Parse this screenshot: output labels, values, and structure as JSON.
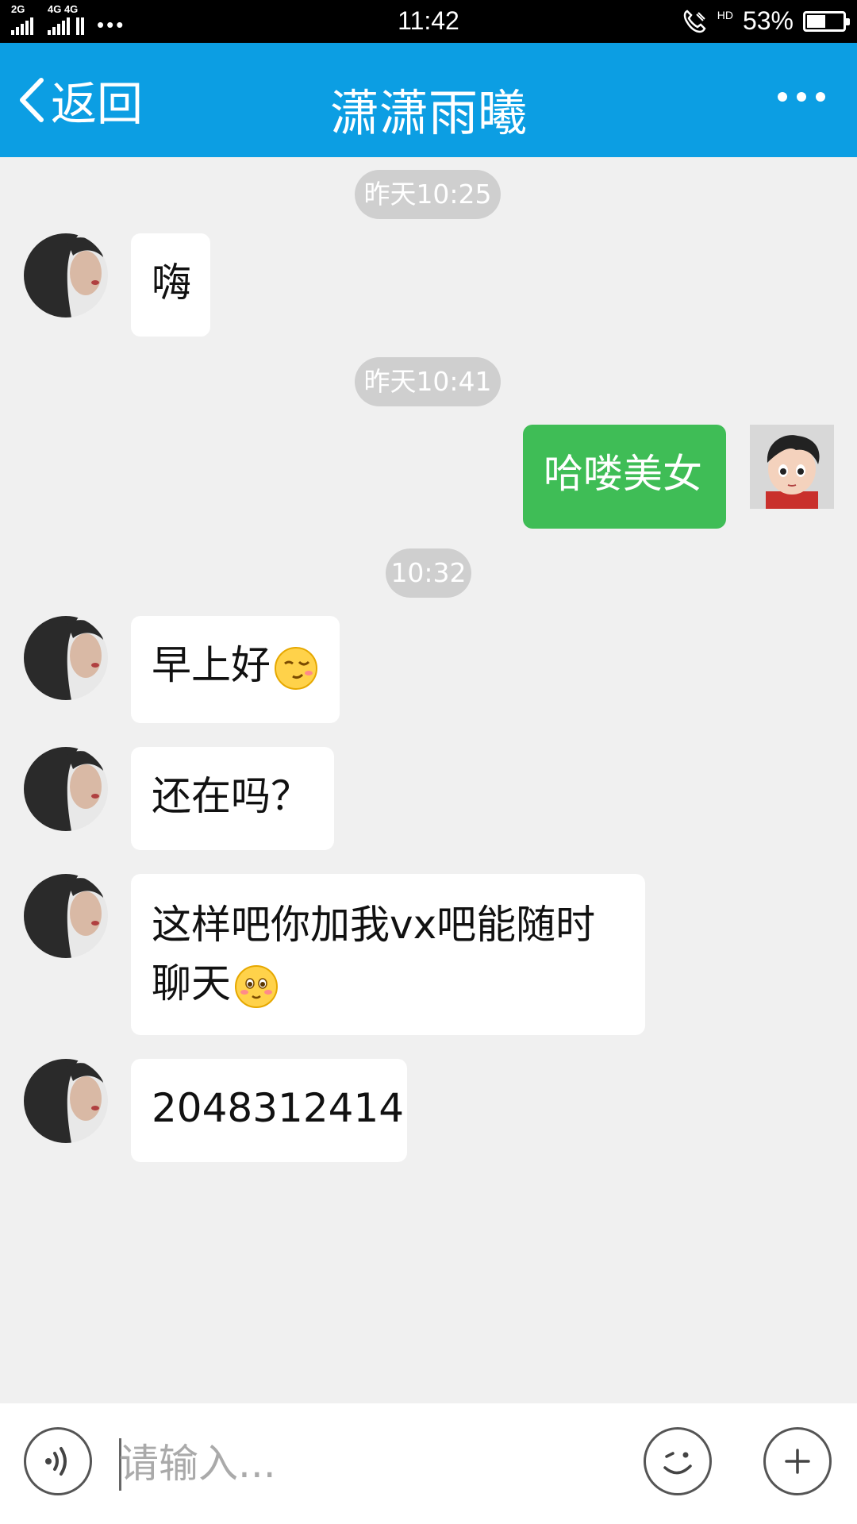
{
  "status_bar": {
    "signal_1_label": "2G",
    "signal_2_label": "4G 4G",
    "more": "•••",
    "time": "11:42",
    "hd": "HD",
    "battery_percent": "53%",
    "battery_level": 0.53
  },
  "header": {
    "back_label": "返回",
    "title": "潇潇雨曦",
    "more_icon": "more-dots-icon",
    "background": "#0c9ee3"
  },
  "messages": [
    {
      "type": "time",
      "text": "昨天10:25"
    },
    {
      "type": "received",
      "text": "嗨"
    },
    {
      "type": "time",
      "text": "昨天10:41"
    },
    {
      "type": "sent",
      "text": "哈喽美女"
    },
    {
      "type": "time",
      "text": "10:32"
    },
    {
      "type": "received",
      "text": "早上好",
      "emoji": "wink-emoji"
    },
    {
      "type": "received",
      "text": "还在吗？"
    },
    {
      "type": "received",
      "text_line1": "这样吧你加我vx吧能随时",
      "text_line2": "聊天",
      "emoji": "blush-emoji"
    },
    {
      "type": "received",
      "text": "2048312414"
    }
  ],
  "input_bar": {
    "voice_icon": "voice-icon",
    "placeholder": "请输入...",
    "emoji_icon": "smiley-icon",
    "plus_icon": "plus-icon"
  },
  "colors": {
    "sent_bubble": "#3fbd56",
    "received_bubble": "#ffffff",
    "chat_background": "#f0f0f0"
  }
}
